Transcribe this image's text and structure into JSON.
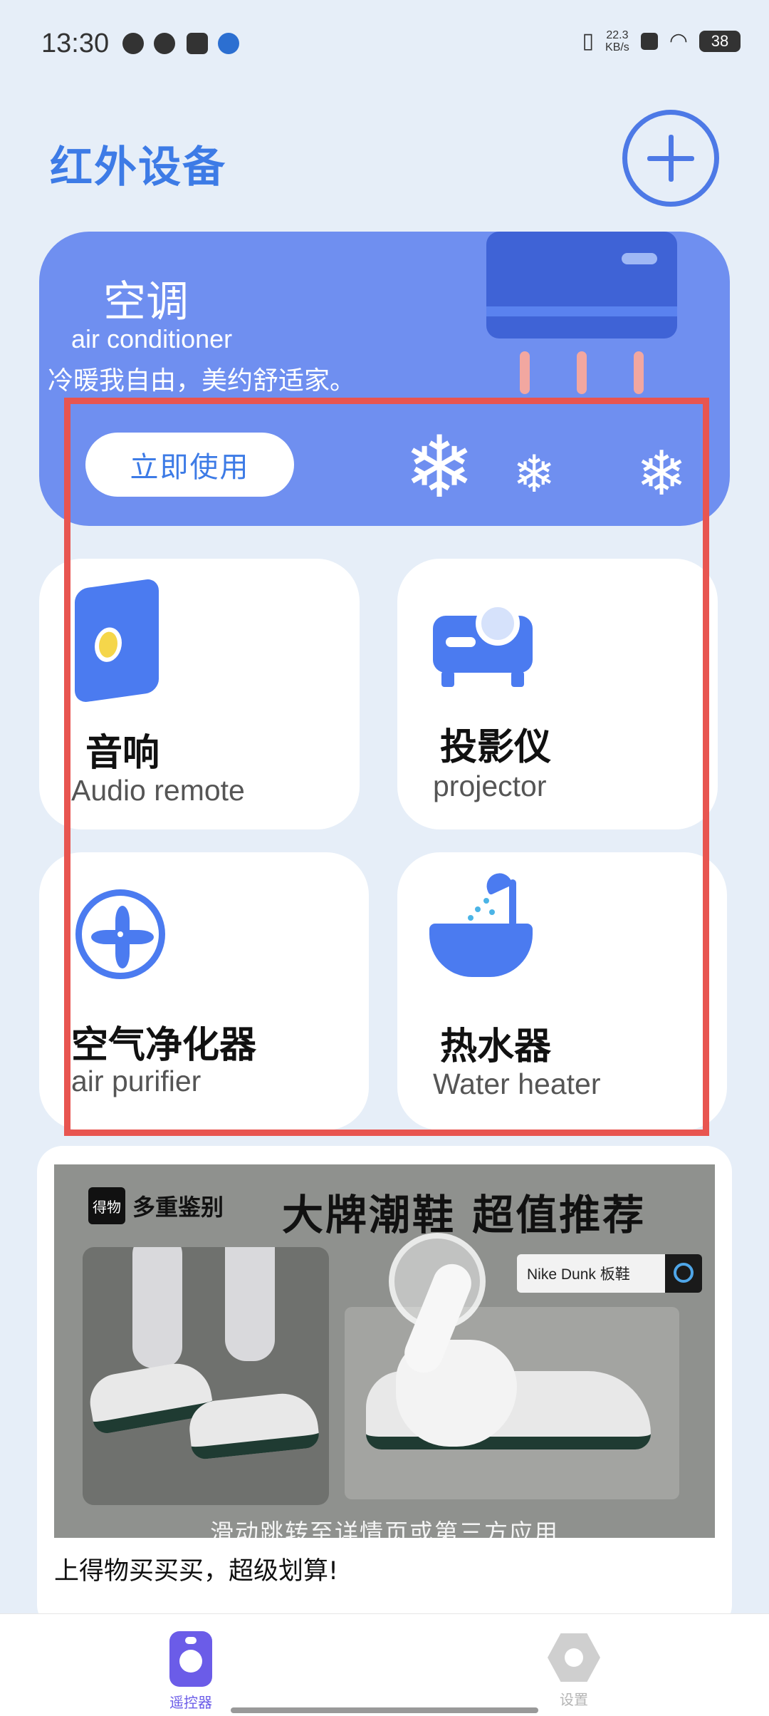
{
  "status_bar": {
    "time": "13:30",
    "net_speed_value": "22.3",
    "net_speed_unit": "KB/s",
    "battery": "38"
  },
  "header": {
    "title": "红外设备",
    "add_icon": "plus-circle-icon"
  },
  "ac_card": {
    "title": "空调",
    "subtitle": "air conditioner",
    "slogan": "冷暖我自由，美约舒适家。",
    "button_label": "立即使用",
    "snowflake": "❄"
  },
  "devices": [
    {
      "name": "音响",
      "en": "Audio  remote",
      "icon": "speaker-icon"
    },
    {
      "name": "投影仪",
      "en": "projector",
      "icon": "projector-icon"
    },
    {
      "name": "空气净化器",
      "en": "air purifier",
      "icon": "fan-icon"
    },
    {
      "name": "热水器",
      "en": "Water heater",
      "icon": "bathtub-icon"
    }
  ],
  "ad": {
    "logo_text": "多重鉴别",
    "logo_box": "得物",
    "headline": "大牌潮鞋 超值推荐",
    "search_text": "Nike Dunk 板鞋",
    "hint": "滑动跳转至详情页或第三方应用",
    "caption": "上得物买买买，超级划算!"
  },
  "bottom_nav": {
    "items": [
      {
        "label": "遥控器",
        "icon": "remote-icon",
        "active": true
      },
      {
        "label": "设置",
        "icon": "settings-icon",
        "active": false
      }
    ]
  },
  "colors": {
    "accent": "#3d7be6",
    "card_blue": "#6f8ff0",
    "highlight": "#e85550",
    "nav_active": "#6b5ce8"
  }
}
